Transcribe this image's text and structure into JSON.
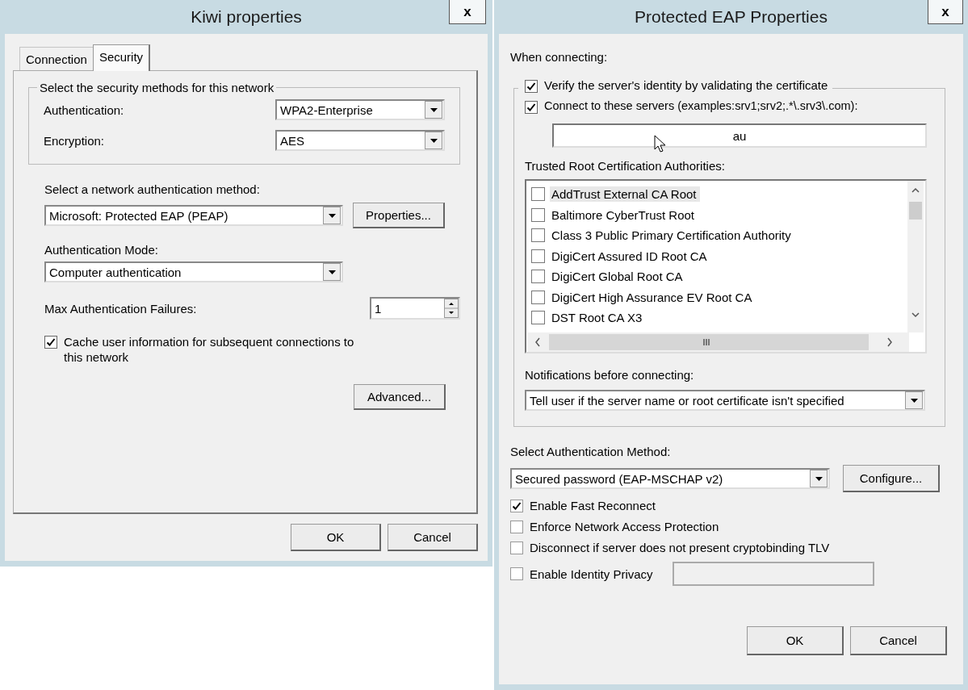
{
  "kiwi": {
    "title": "Kiwi properties",
    "close": "x",
    "tabs": [
      {
        "label": "Connection",
        "selected": false
      },
      {
        "label": "Security",
        "selected": true
      }
    ],
    "group_title": "Select the security methods for this network",
    "authentication": {
      "label": "Authentication:",
      "value": "WPA2-Enterprise"
    },
    "encryption": {
      "label": "Encryption:",
      "value": "AES"
    },
    "method": {
      "label": "Select a network authentication method:",
      "value": "Microsoft: Protected EAP (PEAP)",
      "button": "Properties..."
    },
    "mode": {
      "label": "Authentication Mode:",
      "value": "Computer authentication"
    },
    "failures": {
      "label": "Max Authentication Failures:",
      "value": "1"
    },
    "cache": {
      "label": "Cache user information for subsequent connections to this network",
      "checked": true
    },
    "advanced": "Advanced...",
    "buttons": [
      "OK",
      "Cancel"
    ]
  },
  "peap": {
    "title": "Protected EAP Properties",
    "close": "x",
    "when_connecting": "When connecting:",
    "verify": {
      "label": "Verify the server's identity by validating the certificate",
      "checked": true
    },
    "connect": {
      "label": "Connect to these servers (examples:srv1;srv2;.*\\.srv3\\.com):",
      "checked": true,
      "value": "au"
    },
    "trusted_label": "Trusted Root Certification Authorities:",
    "authorities": [
      {
        "name": "AddTrust External CA Root",
        "checked": false,
        "selected": true
      },
      {
        "name": "Baltimore CyberTrust Root",
        "checked": false,
        "selected": false
      },
      {
        "name": "Class 3 Public Primary Certification Authority",
        "checked": false,
        "selected": false
      },
      {
        "name": "DigiCert Assured ID Root CA",
        "checked": false,
        "selected": false
      },
      {
        "name": "DigiCert Global Root CA",
        "checked": false,
        "selected": false
      },
      {
        "name": "DigiCert High Assurance EV Root CA",
        "checked": false,
        "selected": false
      },
      {
        "name": "DST Root CA X3",
        "checked": false,
        "selected": false
      }
    ],
    "notifications": {
      "label": "Notifications before connecting:",
      "value": "Tell user if the server name or root certificate isn't specified"
    },
    "auth_method": {
      "label": "Select Authentication Method:",
      "value": "Secured password (EAP-MSCHAP v2)",
      "button": "Configure..."
    },
    "options": [
      {
        "label": "Enable Fast Reconnect",
        "checked": true
      },
      {
        "label": "Enforce Network Access Protection",
        "checked": false
      },
      {
        "label": "Disconnect if server does not present cryptobinding TLV",
        "checked": false
      },
      {
        "label": "Enable Identity Privacy",
        "checked": false
      }
    ],
    "identity_field": {
      "disabled": true
    },
    "buttons": [
      "OK",
      "Cancel"
    ]
  }
}
